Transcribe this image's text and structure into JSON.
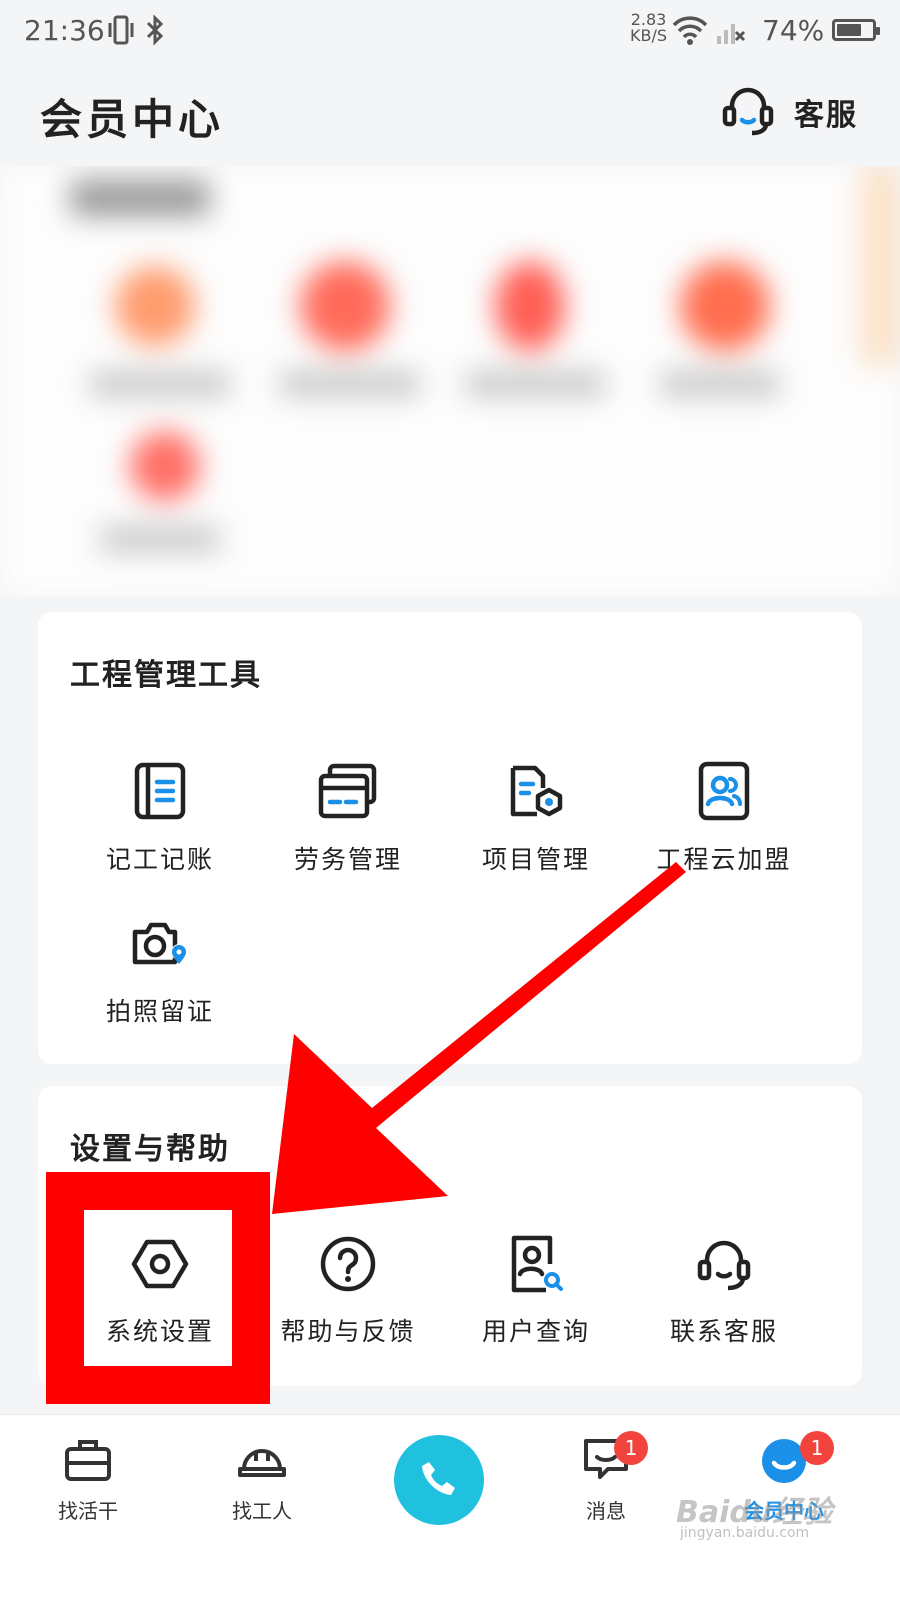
{
  "status_bar": {
    "time": "21:36",
    "net_speed": "2.83",
    "net_speed_unit": "KB/S",
    "battery_text": "74%",
    "battery_level": 0.74
  },
  "header": {
    "title": "会员中心",
    "customer_service_label": "客服"
  },
  "tools_card": {
    "title": "工程管理工具",
    "items": [
      {
        "label": "记工记账",
        "icon": "ledger-icon"
      },
      {
        "label": "劳务管理",
        "icon": "cards-icon"
      },
      {
        "label": "项目管理",
        "icon": "project-folder-icon"
      },
      {
        "label": "工程云加盟",
        "icon": "team-badge-icon"
      },
      {
        "label": "拍照留证",
        "icon": "camera-location-icon"
      }
    ]
  },
  "help_card": {
    "title": "设置与帮助",
    "items": [
      {
        "label": "系统设置",
        "icon": "hexagon-settings-icon"
      },
      {
        "label": "帮助与反馈",
        "icon": "question-icon"
      },
      {
        "label": "用户查询",
        "icon": "user-search-icon"
      },
      {
        "label": "联系客服",
        "icon": "headset-icon"
      }
    ]
  },
  "tab_bar": {
    "items": [
      {
        "label": "找活干",
        "icon": "briefcase-icon"
      },
      {
        "label": "找工人",
        "icon": "hardhat-icon"
      },
      {
        "label": "",
        "icon": "phone-icon"
      },
      {
        "label": "消息",
        "icon": "message-icon",
        "badge": "1"
      },
      {
        "label": "会员中心",
        "icon": "member-icon",
        "badge": "1"
      }
    ]
  },
  "watermark": {
    "text": "Baidu经验",
    "url_text": "jingyan.baidu.com"
  },
  "colors": {
    "accent_blue": "#1a90e8",
    "call_button": "#1fc1de",
    "badge_red": "#f2433d",
    "annotation_red": "#ff0000"
  }
}
